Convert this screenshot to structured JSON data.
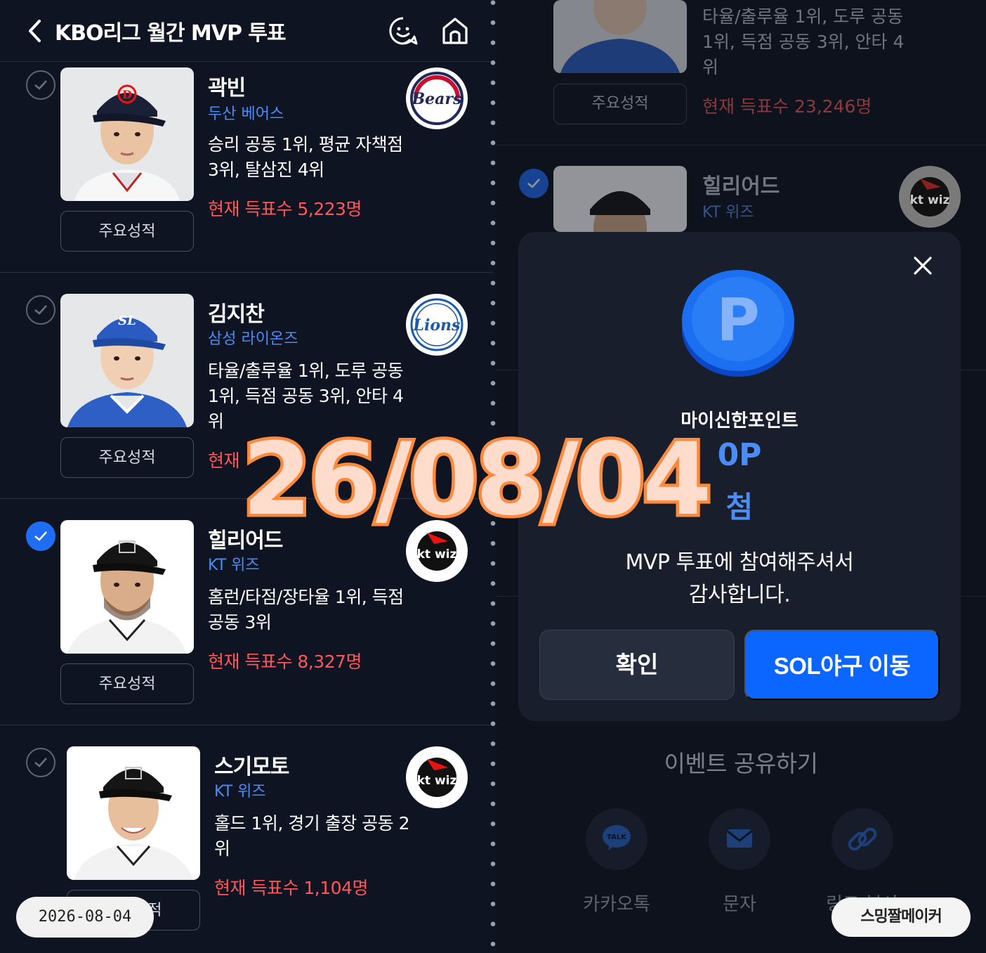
{
  "header": {
    "title": "KBO리그 월간 MVP 투표"
  },
  "players": [
    {
      "name": "곽빈",
      "team": "두산 베어스",
      "desc": "승리 공동 1위, 평균 자책점 3위, 탈삼진 4위",
      "votes": "현재 득표수 5,223명",
      "stats_label": "주요성적",
      "logo": "Bears",
      "checked": false
    },
    {
      "name": "김지찬",
      "team": "삼성 라이온즈",
      "desc": "타율/출루율 1위, 도루 공동 1위, 득점 공동 3위, 안타 4위",
      "votes": "현재",
      "stats_label": "주요성적",
      "logo": "Lions",
      "checked": false
    },
    {
      "name": "힐리어드",
      "team": "KT 위즈",
      "desc": "홈런/타점/장타율 1위, 득점 공동 3위",
      "votes": "현재 득표수 8,327명",
      "stats_label": "주요성적",
      "logo": "kt wiz",
      "checked": true
    },
    {
      "name": "스기모토",
      "team": "KT 위즈",
      "desc": "홀드 1위, 경기 출장 공동 2위",
      "votes": "현재 득표수 1,104명",
      "stats_label": "주요성적",
      "logo": "kt wiz",
      "checked": false
    }
  ],
  "right_bg": {
    "desc": "타율/출루율 1위, 도루 공동 1위, 득점 공동 3위, 안타 4위",
    "votes": "현재 득표수 23,246명",
    "stats_label": "주요성적",
    "name": "힐리어드",
    "team": "KT 위즈",
    "logo": "kt wiz"
  },
  "modal": {
    "point_label": "마이신한포인트",
    "amount": "0P",
    "win": "첨",
    "thanks_line1": "MVP 투표에 참여해주셔서",
    "thanks_line2": "감사합니다.",
    "confirm": "확인",
    "sol": "SOL야구 이동",
    "coin_letter": "P"
  },
  "share": {
    "title": "이벤트 공유하기",
    "items": [
      {
        "label": "카카오톡",
        "icon": "kakaotalk-icon",
        "badge": "TALK"
      },
      {
        "label": "문자",
        "icon": "mail-icon"
      },
      {
        "label": "링크 복사",
        "icon": "link-icon"
      }
    ]
  },
  "overlay": {
    "stamp_date": "26/08/04",
    "pill_date": "2026-08-04",
    "maker": "스밍짤메이커"
  },
  "colors": {
    "accent": "#1f6df2",
    "votes": "#ff5757",
    "team": "#4b8cf5",
    "stamp_fill": "#ffdccc",
    "stamp_stroke": "#ff8a3d"
  }
}
